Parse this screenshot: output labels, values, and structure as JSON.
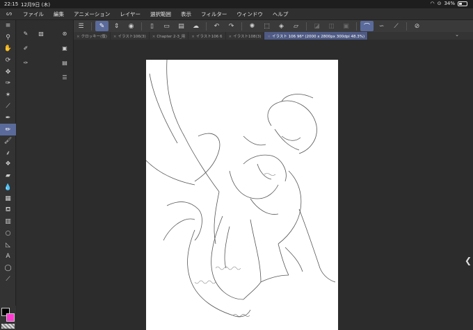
{
  "status": {
    "time": "22:15",
    "date": "12月9日 (木)",
    "battery": "34%"
  },
  "menu": {
    "items": [
      "ファイル",
      "編集",
      "アニメーション",
      "レイヤー",
      "選択範囲",
      "表示",
      "フィルター",
      "ウィンドウ",
      "ヘルプ"
    ]
  },
  "tabs": [
    {
      "label": "クロッキー(復)",
      "active": false
    },
    {
      "label": "イラスト106(3)",
      "active": false
    },
    {
      "label": "Chapter 2-3_用",
      "active": false
    },
    {
      "label": "イラスト106 6",
      "active": false
    },
    {
      "label": "イラスト108(3)",
      "active": false
    },
    {
      "label": "イラスト 106 96* (2000 x 2800px 300dpi 48.3%)",
      "active": true
    }
  ],
  "colors": {
    "accent": "#5a6a9a",
    "main_color": "#000000",
    "sub_color": "#ff3ad0"
  }
}
